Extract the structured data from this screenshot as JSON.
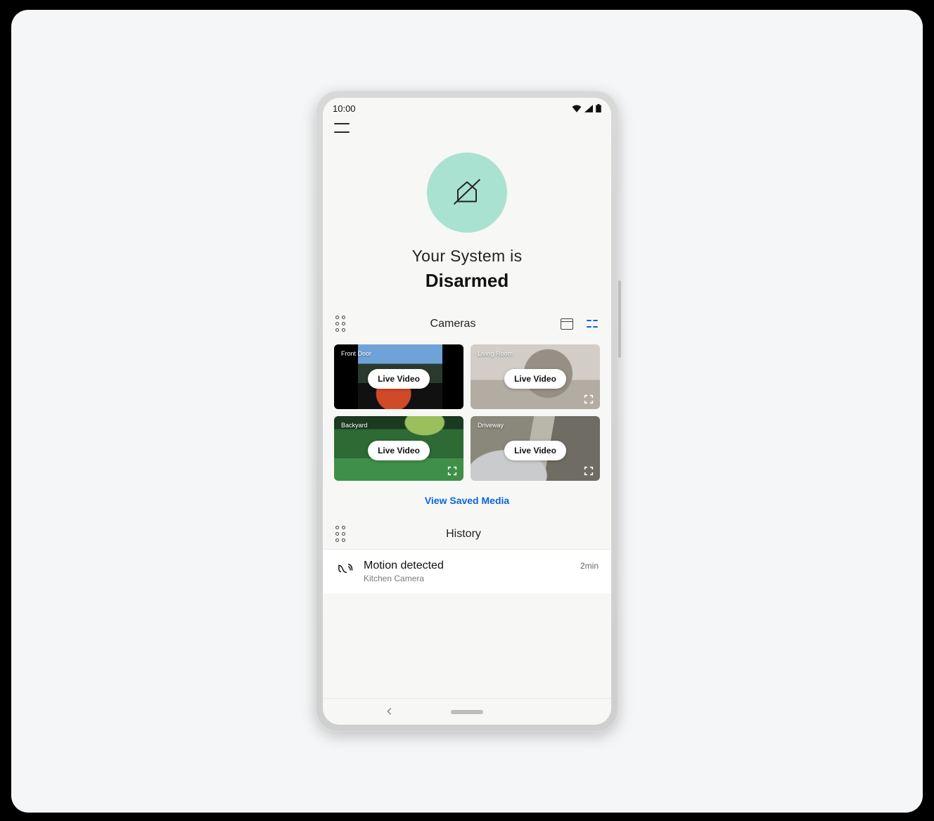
{
  "statusbar": {
    "time": "10:00"
  },
  "system": {
    "line1": "Your System is",
    "state": "Disarmed"
  },
  "sections": {
    "cameras_title": "Cameras",
    "history_title": "History"
  },
  "cameras": [
    {
      "name": "Front Door",
      "cta": "Live Video"
    },
    {
      "name": "Living Room",
      "cta": "Live Video"
    },
    {
      "name": "Backyard",
      "cta": "Live Video"
    },
    {
      "name": "Driveway",
      "cta": "Live Video"
    }
  ],
  "links": {
    "view_saved_media": "View Saved Media"
  },
  "history": [
    {
      "title": "Motion detected",
      "subtitle": "Kitchen Camera",
      "time": "2min"
    }
  ],
  "colors": {
    "accent_blue": "#0a66d6",
    "status_circle": "#a9e2d1"
  }
}
